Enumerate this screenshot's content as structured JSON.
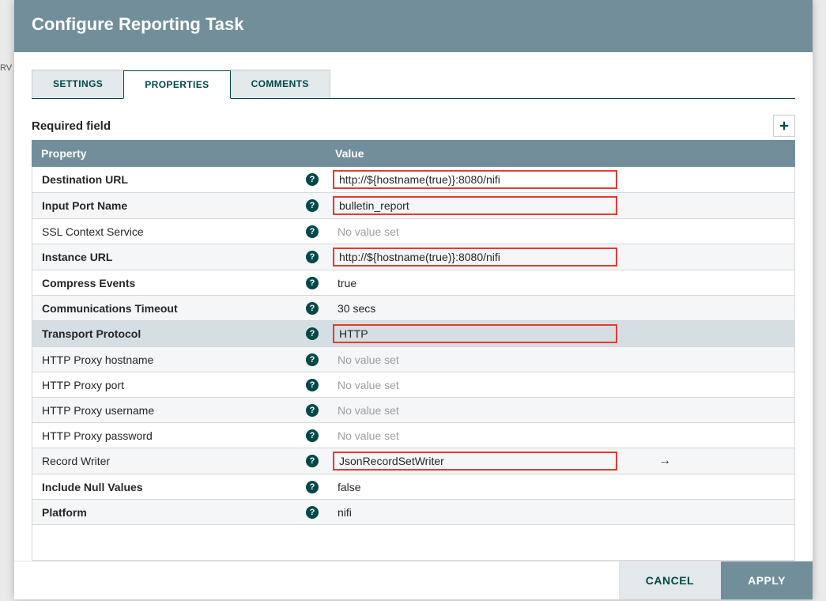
{
  "dialog": {
    "title": "Configure Reporting Task",
    "tabs": {
      "settings": "SETTINGS",
      "properties": "PROPERTIES",
      "comments": "COMMENTS"
    },
    "required_label": "Required field",
    "header": {
      "property": "Property",
      "value": "Value"
    },
    "buttons": {
      "cancel": "CANCEL",
      "apply": "APPLY"
    },
    "no_value_text": "No value set"
  },
  "rows": [
    {
      "name": "Destination URL",
      "required": true,
      "value": "http://${hostname(true)}:8080/nifi",
      "highlight": true
    },
    {
      "name": "Input Port Name",
      "required": true,
      "value": "bulletin_report",
      "highlight": true
    },
    {
      "name": "SSL Context Service",
      "required": false,
      "value": "",
      "highlight": false
    },
    {
      "name": "Instance URL",
      "required": true,
      "value": "http://${hostname(true)}:8080/nifi",
      "highlight": true
    },
    {
      "name": "Compress Events",
      "required": true,
      "value": "true",
      "highlight": false
    },
    {
      "name": "Communications Timeout",
      "required": true,
      "value": "30 secs",
      "highlight": false
    },
    {
      "name": "Transport Protocol",
      "required": true,
      "value": "HTTP",
      "highlight": true,
      "selected": true
    },
    {
      "name": "HTTP Proxy hostname",
      "required": false,
      "value": "",
      "highlight": false
    },
    {
      "name": "HTTP Proxy port",
      "required": false,
      "value": "",
      "highlight": false
    },
    {
      "name": "HTTP Proxy username",
      "required": false,
      "value": "",
      "highlight": false
    },
    {
      "name": "HTTP Proxy password",
      "required": false,
      "value": "",
      "highlight": false
    },
    {
      "name": "Record Writer",
      "required": false,
      "value": "JsonRecordSetWriter",
      "highlight": true,
      "goto": true
    },
    {
      "name": "Include Null Values",
      "required": true,
      "value": "false",
      "highlight": false
    },
    {
      "name": "Platform",
      "required": true,
      "value": "nifi",
      "highlight": false
    }
  ],
  "background": {
    "rv_text": "RV"
  }
}
